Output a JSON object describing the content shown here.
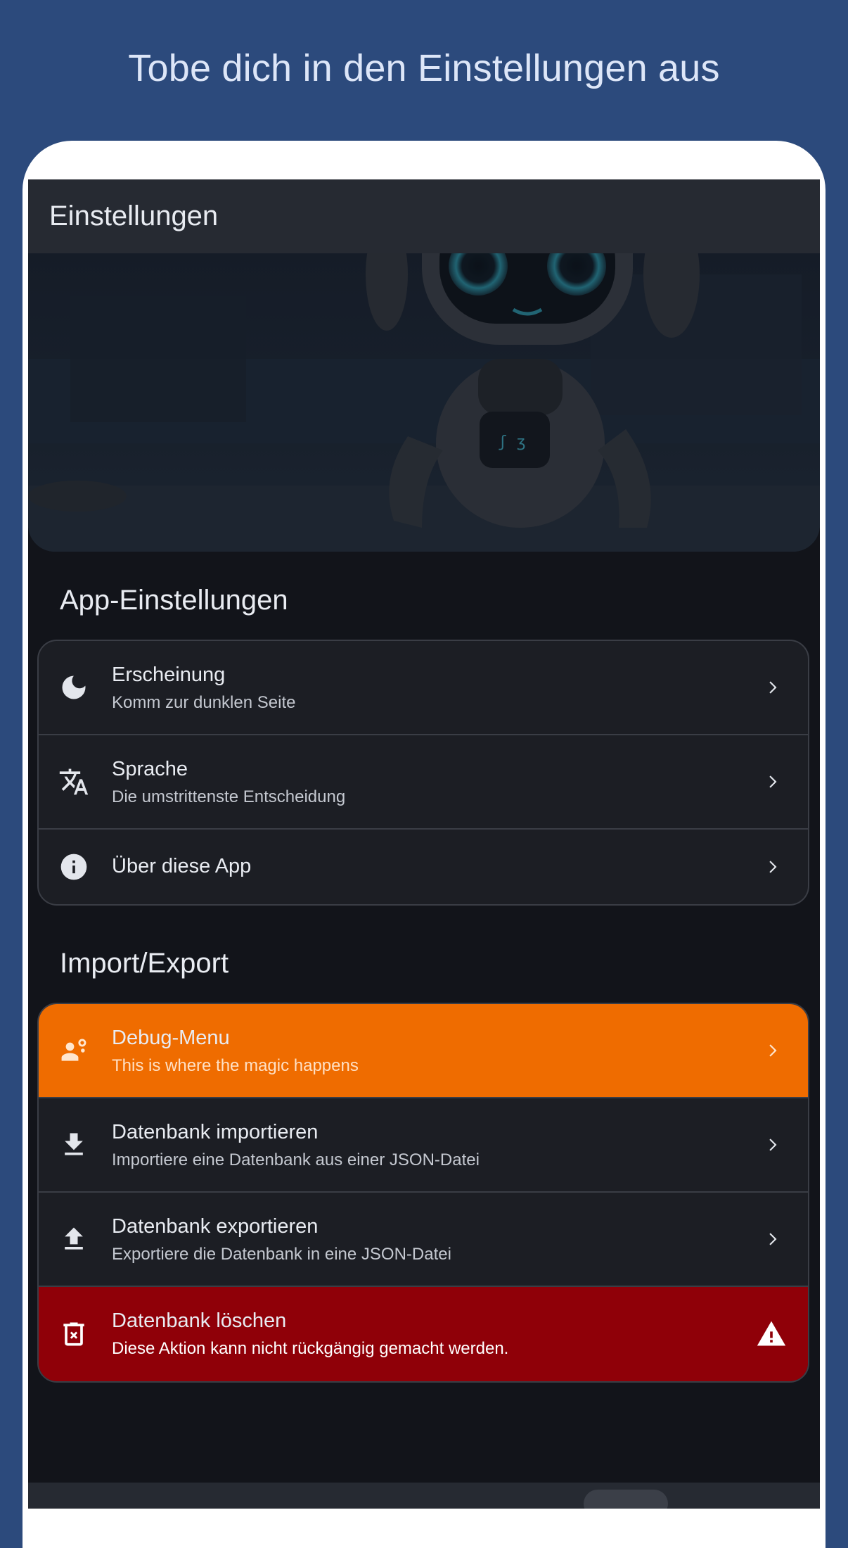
{
  "headline": "Tobe dich in den Einstellungen aus",
  "appbar": {
    "title": "Einstellungen"
  },
  "hero": {
    "image": "robot-illustration"
  },
  "sections": {
    "app": {
      "title": "App-Einstellungen",
      "items": [
        {
          "title": "Erscheinung",
          "subtitle": "Komm zur dunklen Seite",
          "icon": "moon-icon"
        },
        {
          "title": "Sprache",
          "subtitle": "Die umstrittenste Entscheidung",
          "icon": "translate-icon"
        },
        {
          "title": "Über diese App",
          "icon": "info-icon"
        }
      ]
    },
    "io": {
      "title": "Import/Export",
      "items": [
        {
          "title": "Debug-Menu",
          "subtitle": "This is where the magic happens",
          "icon": "engineer-icon",
          "color": "#ef6c00"
        },
        {
          "title": "Datenbank importieren",
          "subtitle": "Importiere eine Datenbank aus einer JSON-Datei",
          "icon": "download-icon"
        },
        {
          "title": "Datenbank exportieren",
          "subtitle": "Exportiere die Datenbank in eine JSON-Datei",
          "icon": "upload-icon"
        },
        {
          "title": "Datenbank löschen",
          "subtitle": "Diese Aktion kann nicht rückgängig gemacht werden.",
          "icon": "delete-icon",
          "trailing_icon": "warning-icon",
          "color": "#8f0008"
        }
      ]
    }
  }
}
